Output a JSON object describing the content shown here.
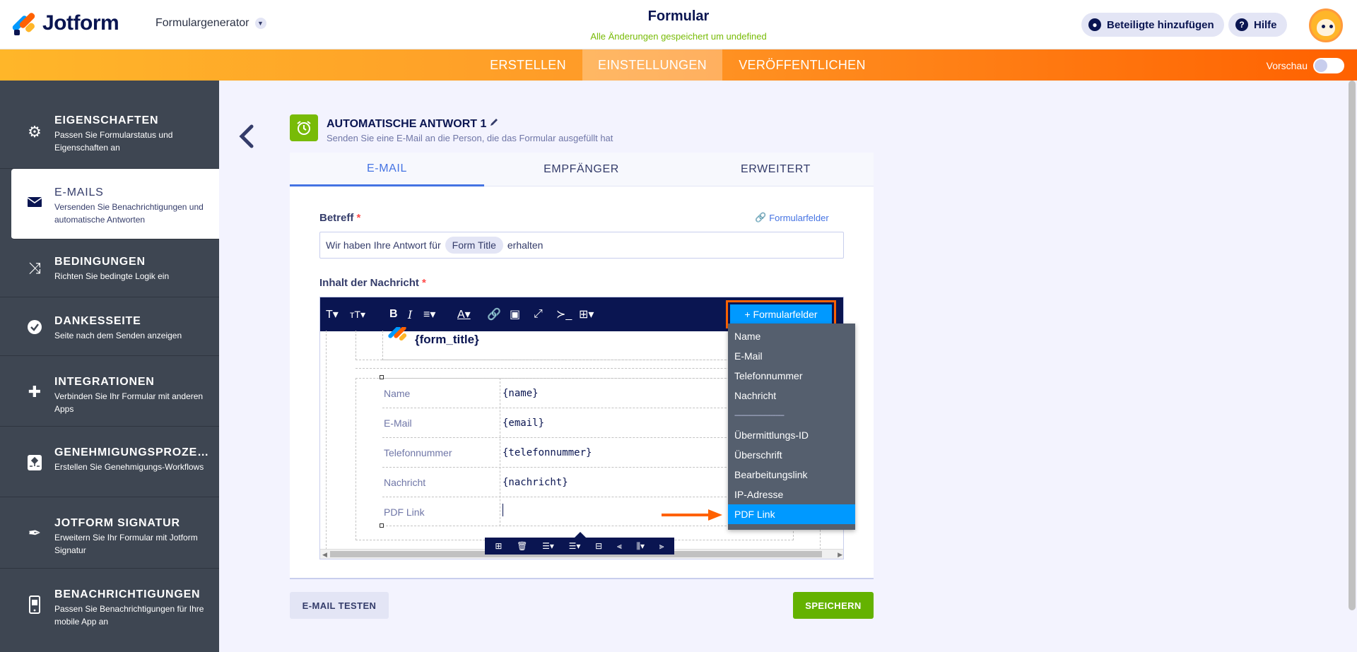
{
  "app": {
    "logo_text": "Jotform",
    "builder_label": "Formulargenerator",
    "form_title": "Formular",
    "save_status": "Alle Änderungen gespeichert um undefined",
    "invite_label": "Beteiligte hinzufügen",
    "help_label": "Hilfe"
  },
  "nav": {
    "tabs": [
      "ERSTELLEN",
      "EINSTELLUNGEN",
      "VERÖFFENTLICHEN"
    ],
    "active_tab": "EINSTELLUNGEN",
    "preview_label": "Vorschau"
  },
  "sidebar": {
    "items": [
      {
        "title": "EIGENSCHAFTEN",
        "desc": "Passen Sie Formularstatus und Eigenschaften an",
        "icon": "gear-icon"
      },
      {
        "title": "E-MAILS",
        "desc": "Versenden Sie Benachrichtigungen und automatische Antworten",
        "icon": "envelope-icon"
      },
      {
        "title": "BEDINGUNGEN",
        "desc": "Richten Sie bedingte Logik ein",
        "icon": "shuffle-icon"
      },
      {
        "title": "DANKESSEITE",
        "desc": "Seite nach dem Senden anzeigen",
        "icon": "check-circle-icon"
      },
      {
        "title": "INTEGRATIONEN",
        "desc": "Verbinden Sie Ihr Formular mit anderen Apps",
        "icon": "puzzle-icon"
      },
      {
        "title": "GENEHMIGUNGSPROZESSE",
        "desc": "Erstellen Sie Genehmigungs-Workflows",
        "icon": "flow-icon"
      },
      {
        "title": "JOTFORM SIGNATUR",
        "desc": "Erweitern Sie Ihr Formular mit Jotform Signatur",
        "icon": "pen-icon"
      },
      {
        "title": "BENACHRICHTIGUNGEN",
        "desc": "Passen Sie Benachrichtigungen für Ihre mobile App an",
        "icon": "mobile-icon"
      }
    ],
    "active_index": 1
  },
  "email_header": {
    "title": "AUTOMATISCHE ANTWORT 1",
    "subtitle": "Senden Sie eine E-Mail an die Person, die das Formular ausgefüllt hat"
  },
  "email_tabs": [
    "E-MAIL",
    "EMPFÄNGER",
    "ERWEITERT"
  ],
  "subject": {
    "label": "Betreff",
    "required_mark": "*",
    "form_fields_link": "Formularfelder",
    "prefix": "Wir haben Ihre Antwort für",
    "chip": "Form Title",
    "suffix": "erhalten"
  },
  "message": {
    "label": "Inhalt der Nachricht",
    "required_mark": "*",
    "form_fields_button": "+ Formularfelder",
    "form_title_tag": "{form_title}",
    "rows": [
      {
        "label": "Name",
        "value": "{name}"
      },
      {
        "label": "E-Mail",
        "value": "{email}"
      },
      {
        "label": "Telefonnummer",
        "value": "{telefonnummer}"
      },
      {
        "label": "Nachricht",
        "value": "{nachricht}"
      },
      {
        "label": "PDF Link",
        "value": ""
      }
    ]
  },
  "dropdown": {
    "items": [
      "Name",
      "E-Mail",
      "Telefonnummer",
      "Nachricht",
      "------------------------------",
      "Übermittlungs-ID",
      "Überschrift",
      "Bearbeitungslink",
      "IP-Adresse",
      "PDF Link"
    ],
    "selected": "PDF Link"
  },
  "actions": {
    "test_label": "E-MAIL TESTEN",
    "save_label": "SPEICHERN"
  },
  "colors": {
    "accent_orange": "#ff6100",
    "accent_blue": "#0099ff",
    "success_green": "#64b200",
    "navy": "#0a1551"
  }
}
